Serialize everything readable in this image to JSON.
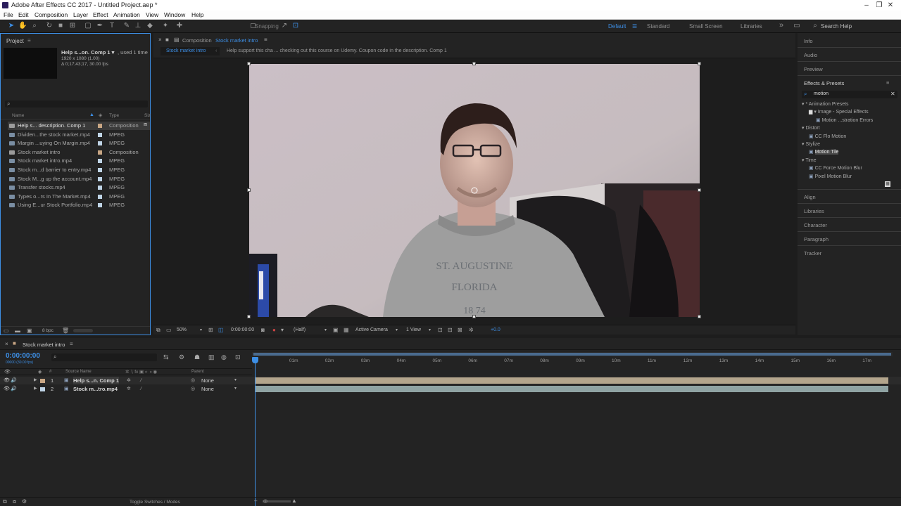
{
  "window": {
    "title": "Adobe After Effects CC 2017 - Untitled Project.aep *",
    "minimize": "–",
    "maximize": "❐",
    "close": "✕"
  },
  "menu": [
    "File",
    "Edit",
    "Composition",
    "Layer",
    "Effect",
    "Animation",
    "View",
    "Window",
    "Help"
  ],
  "toolbar": {
    "snapping_label": "Snapping",
    "workspaces": [
      "Default",
      "Standard",
      "Small Screen",
      "Libraries"
    ],
    "search_help": "Search Help",
    "more": "»"
  },
  "project": {
    "panel_title": "Project",
    "selected_info": {
      "name": "Help s...on. Comp 1 ▾",
      "used": ", used 1 time",
      "size": "1920 x 1080 (1.00)",
      "duration": "Δ 0;17;43;17, 30.00 fps"
    },
    "search_placeholder": "",
    "columns": {
      "name": "Name",
      "type": "Type",
      "size": "Siz"
    },
    "items": [
      {
        "name": "Help s... description. Comp 1",
        "type": "Composition",
        "label_color": "#c8a684",
        "icon": "composition-icon",
        "selected": true
      },
      {
        "name": "Dividen...the stock market.mp4",
        "type": "MPEG",
        "label_color": "#bfd4e6",
        "icon": "footage-icon"
      },
      {
        "name": "Margin ...uying On Margin.mp4",
        "type": "MPEG",
        "label_color": "#bfd4e6",
        "icon": "footage-icon"
      },
      {
        "name": "Stock market intro",
        "type": "Composition",
        "label_color": "#c8a684",
        "icon": "composition-icon"
      },
      {
        "name": "Stock market intro.mp4",
        "type": "MPEG",
        "label_color": "#bfd4e6",
        "icon": "footage-icon"
      },
      {
        "name": "Stock m...d barrier to entry.mp4",
        "type": "MPEG",
        "label_color": "#bfd4e6",
        "icon": "footage-icon"
      },
      {
        "name": "Stock M...g up the account.mp4",
        "type": "MPEG",
        "label_color": "#bfd4e6",
        "icon": "footage-icon"
      },
      {
        "name": "Transfer stocks.mp4",
        "type": "MPEG",
        "label_color": "#bfd4e6",
        "icon": "footage-icon"
      },
      {
        "name": "Types o...rs In The Market.mp4",
        "type": "MPEG",
        "label_color": "#bfd4e6",
        "icon": "footage-icon"
      },
      {
        "name": "Using E...ur Stock Portfolio.mp4",
        "type": "MPEG",
        "label_color": "#bfd4e6",
        "icon": "footage-icon"
      }
    ],
    "bpc": "8 bpc"
  },
  "composition": {
    "panel_title_prefix": "Composition",
    "panel_title_name": "Stock market intro",
    "breadcrumb_active": "Stock market intro",
    "breadcrumb_next": "Help support this cha ... checking out this course on Udemy. Coupon code in the description. Comp 1",
    "footer": {
      "zoom": "50%",
      "timecode": "0:00:00:00",
      "resolution": "(Half)",
      "camera": "Active Camera",
      "views": "1 View",
      "exposure": "+0.0"
    },
    "shirt_text_1": "ST. AUGUSTINE",
    "shirt_text_2": "FLORIDA",
    "shirt_text_3": "18   74"
  },
  "right_panel": {
    "info": "Info",
    "audio": "Audio",
    "preview": "Preview",
    "effects_presets": "Effects & Presets",
    "search_value": "motion",
    "tree": [
      {
        "label": "▾ * Animation Presets",
        "level": 0
      },
      {
        "label": "▾ Image - Special Effects",
        "level": 1,
        "folder": true
      },
      {
        "label": "Motion ...stration Errors",
        "level": 2,
        "effect": true
      },
      {
        "label": "▾ Distort",
        "level": 0
      },
      {
        "label": "CC Flo Motion",
        "level": 1,
        "effect": true
      },
      {
        "label": "▾ Stylize",
        "level": 0
      },
      {
        "label": "Motion Tile",
        "level": 1,
        "effect": true,
        "selected": true
      },
      {
        "label": "▾ Time",
        "level": 0
      },
      {
        "label": "CC Force Motion Blur",
        "level": 1,
        "effect": true
      },
      {
        "label": "Pixel Motion Blur",
        "level": 1,
        "effect": true
      }
    ],
    "align": "Align",
    "libraries": "Libraries",
    "character": "Character",
    "paragraph": "Paragraph",
    "tracker": "Tracker"
  },
  "timeline": {
    "tab_name": "Stock market intro",
    "timecode": "0:00:00:00",
    "timecode_sub": "00000 (30.00 fps)",
    "col_source": "Source Name",
    "col_parent": "Parent",
    "layers": [
      {
        "num": "1",
        "name": "Help s...n. Comp 1",
        "parent": "None",
        "label_color": "#c8a684",
        "bar_color": "#b3a58c"
      },
      {
        "num": "2",
        "name": "Stock m...tro.mp4",
        "parent": "None",
        "label_color": "#bfd4e6",
        "bar_color": "#8fa3a3"
      }
    ],
    "ruler": [
      "0f",
      "01m",
      "02m",
      "03m",
      "04m",
      "05m",
      "06m",
      "07m",
      "08m",
      "09m",
      "10m",
      "11m",
      "12m",
      "13m",
      "14m",
      "15m",
      "16m",
      "17m"
    ],
    "toggle_label": "Toggle Switches / Modes"
  },
  "colors": {
    "accent": "#3d8fe6",
    "panel": "#232323",
    "background": "#1d1d1d"
  }
}
